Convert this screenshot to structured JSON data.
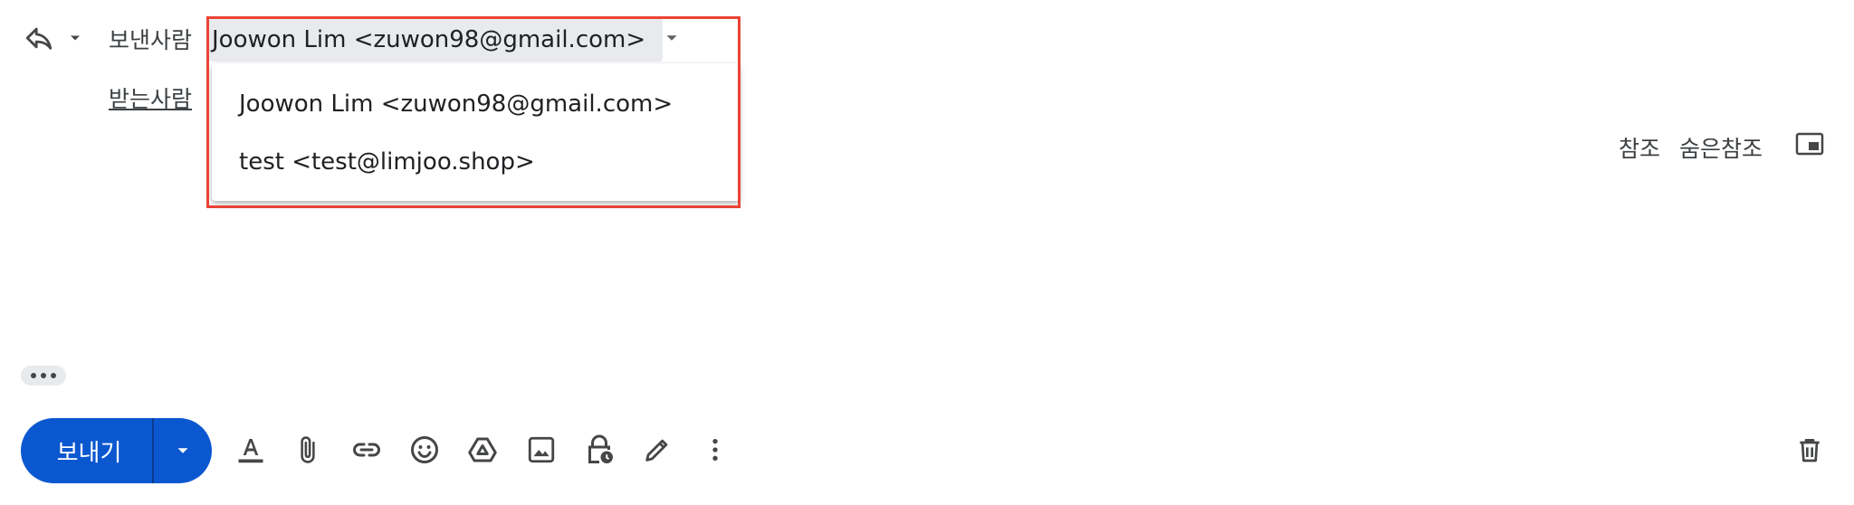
{
  "header": {
    "from_label": "보낸사람",
    "from_value": "Joowon Lim <zuwon98@gmail.com>",
    "to_label": "받는사람",
    "reply_icon": "reply-icon",
    "reply_caret_icon": "caret-down-icon"
  },
  "from_menu": {
    "items": [
      {
        "label": "Joowon Lim <zuwon98@gmail.com>"
      },
      {
        "label": "test <test@limjoo.shop>"
      }
    ]
  },
  "recipients": {
    "cc_label": "참조",
    "bcc_label": "숨은참조",
    "popout_icon": "popout-icon"
  },
  "toolbar": {
    "send_label": "보내기",
    "icons": [
      "formatting-icon",
      "attach-icon",
      "link-icon",
      "emoji-icon",
      "drive-icon",
      "photo-icon",
      "confidential-icon",
      "signature-icon",
      "more-options-icon"
    ],
    "trash_icon": "trash-icon"
  },
  "colors": {
    "send_button": "#0b57d0",
    "highlight": "#ea4335",
    "chip_bg": "#e8eaed"
  }
}
